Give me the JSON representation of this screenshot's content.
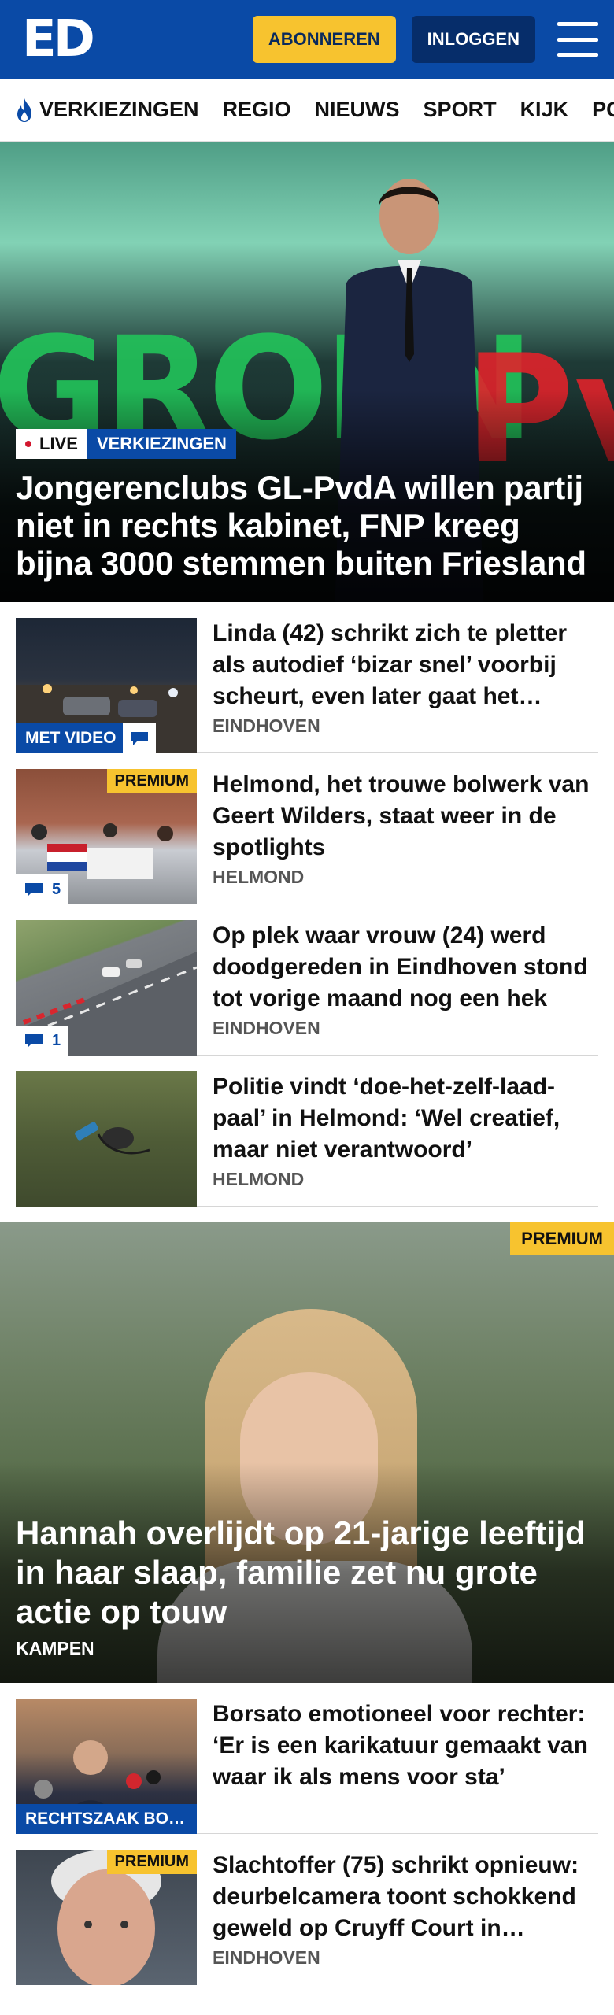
{
  "header": {
    "logo": "ED",
    "subscribe_label": "ABONNEREN",
    "login_label": "INLOGGEN"
  },
  "nav": {
    "items": [
      "VERKIEZINGEN",
      "REGIO",
      "NIEUWS",
      "SPORT",
      "KIJK",
      "PODCASTS"
    ]
  },
  "hero": {
    "live_label": "LIVE",
    "topic_label": "VERKIEZINGEN",
    "title": "Jongerenclubs GL-PvdA willen partij niet in rechts kabinet, FNP kreeg bijna 3000 stemmen buiten Friesland",
    "backdrop_text_green": "GROEN",
    "backdrop_text_red": "PvdA"
  },
  "articles": [
    {
      "title": "Linda (42) schrikt zich te pletter als autodief ‘bizar snel’ voorbij scheurt, even later gaat het…",
      "location": "EINDHOVEN",
      "video_label": "MET VIDEO"
    },
    {
      "title": "Helmond, het trouwe bolwerk van Geert Wilders, staat weer in de spotlights",
      "location": "HELMOND",
      "premium_label": "PREMIUM",
      "comments": "5"
    },
    {
      "title": "Op plek waar vrouw (24) werd doodgereden in Eindhoven stond tot vorige maand nog een hek",
      "location": "EINDHOVEN",
      "comments": "1"
    },
    {
      "title": "Politie vindt ‘doe-het-zelf-laad-paal’ in Helmond: ‘Wel creatief, maar niet verantwoord’",
      "location": "HELMOND"
    }
  ],
  "feature": {
    "premium_label": "PREMIUM",
    "title": "Hannah overlijdt op 21-jarige leeftijd in haar slaap, familie zet nu grote actie op touw",
    "location": "KAMPEN"
  },
  "articles2": [
    {
      "title": "Borsato emotioneel voor rechter: ‘Er is een karikatuur gemaakt van waar ik als mens voor sta’",
      "topic_label": "RECHTSZAAK BO…"
    },
    {
      "title": "Slachtoffer (75) schrikt opnieuw: deurbelcamera toont schokkend geweld op Cruyff Court in…",
      "location": "EINDHOVEN",
      "premium_label": "PREMIUM"
    }
  ],
  "colors": {
    "brand_blue": "#0a4aa6",
    "premium_yellow": "#f7c32f",
    "live_red": "#d2162e"
  }
}
